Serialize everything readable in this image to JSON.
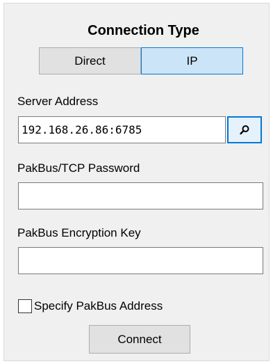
{
  "connection_type": {
    "title": "Connection Type",
    "options": [
      "Direct",
      "IP"
    ],
    "selected": "IP"
  },
  "server_address": {
    "label": "Server Address",
    "value": "192.168.26.86:6785",
    "browse_icon": "search-icon"
  },
  "tcp_password": {
    "label": "PakBus/TCP Password",
    "value": ""
  },
  "encryption_key": {
    "label": "PakBus Encryption Key",
    "value": ""
  },
  "specify_address": {
    "label": "Specify PakBus Address",
    "checked": false
  },
  "connect": {
    "label": "Connect"
  },
  "colors": {
    "panel_bg": "#f0f0f0",
    "selected_segment_bg": "#cce4f7",
    "accent_border": "#0078d7",
    "button_bg": "#e1e1e1"
  }
}
